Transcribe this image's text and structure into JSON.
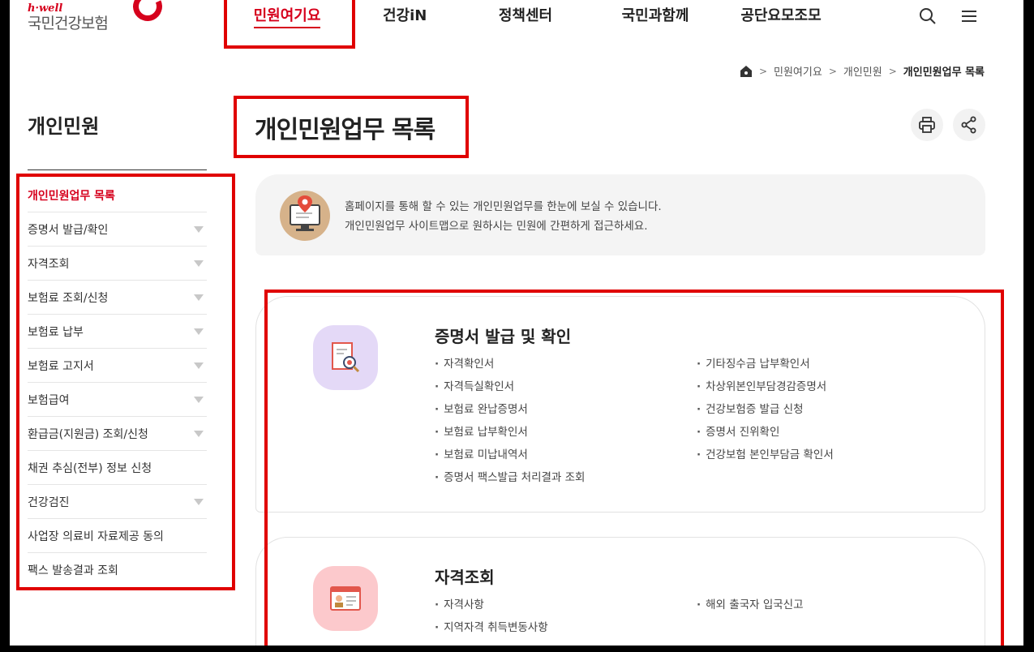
{
  "header": {
    "logo_top": "h·well",
    "logo_main": "국민건강보험",
    "nav": [
      "민원여기요",
      "건강iN",
      "정책센터",
      "국민과함께",
      "공단요모조모"
    ],
    "active_nav": 0,
    "search_icon": "search-icon",
    "menu_icon": "hamburger-menu-icon"
  },
  "breadcrumb": {
    "items": [
      "민원여기요",
      "개인민원"
    ],
    "current": "개인민원업무 목록"
  },
  "sidebar": {
    "title": "개인민원",
    "items": [
      {
        "label": "개인민원업무 목록",
        "active": true,
        "arrow": false
      },
      {
        "label": "증명서 발급/확인",
        "arrow": true
      },
      {
        "label": "자격조회",
        "arrow": true
      },
      {
        "label": "보험료 조회/신청",
        "arrow": true
      },
      {
        "label": "보험료 납부",
        "arrow": true
      },
      {
        "label": "보험료 고지서",
        "arrow": true
      },
      {
        "label": "보험급여",
        "arrow": true
      },
      {
        "label": "환급금(지원금) 조회/신청",
        "arrow": true
      },
      {
        "label": "채권 추심(전부) 정보 신청",
        "arrow": false
      },
      {
        "label": "건강검진",
        "arrow": true
      },
      {
        "label": "사업장 의료비 자료제공 동의",
        "arrow": false
      },
      {
        "label": "팩스 발송결과 조회",
        "arrow": false
      }
    ]
  },
  "main": {
    "title": "개인민원업무 목록",
    "info_line1": "홈페이지를 통해 할 수 있는 개인민원업무를 한눈에 보실 수 있습니다.",
    "info_line2": "개인민원업무 사이트맵으로 원하시는 민원에 간편하게 접근하세요.",
    "cards": [
      {
        "title": "증명서 발급 및 확인",
        "icon": "certificate-search-icon",
        "icon_bg": "#e4d9f7",
        "left": [
          "자격확인서",
          "자격득실확인서",
          "보험료 완납증명서",
          "보험료 납부확인서",
          "보험료 미납내역서",
          "증명서 팩스발급 처리결과 조회"
        ],
        "right": [
          "기타징수금 납부확인서",
          "차상위본인부담경감증명서",
          "건강보험증 발급 신청",
          "증명서 진위확인",
          "건강보험 본인부담금 확인서"
        ]
      },
      {
        "title": "자격조회",
        "icon": "id-card-icon",
        "icon_bg": "#fcc9cc",
        "left": [
          "자격사항",
          "지역자격 취득변동사항"
        ],
        "right": [
          "해외 출국자 입국신고"
        ]
      }
    ]
  },
  "colors": {
    "brand": "#d6001c",
    "annotation": "#e00000"
  }
}
